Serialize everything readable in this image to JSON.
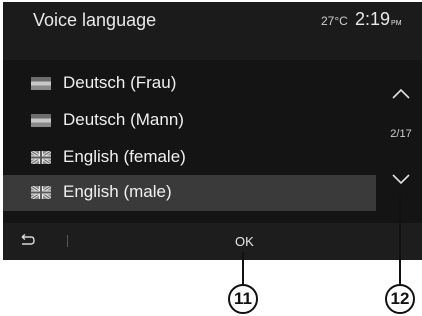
{
  "header": {
    "title": "Voice language",
    "temperature": "27°C",
    "time": "2:19",
    "ampm": "PM"
  },
  "list": {
    "items": [
      {
        "label": "Deutsch (Frau)",
        "flag": "germany-flag-icon",
        "selected": false
      },
      {
        "label": "Deutsch (Mann)",
        "flag": "germany-flag-icon",
        "selected": false
      },
      {
        "label": "English (female)",
        "flag": "uk-flag-icon",
        "selected": false
      },
      {
        "label": "English (male)",
        "flag": "uk-flag-icon",
        "selected": true
      }
    ]
  },
  "pager": {
    "up_icon": "chevron-up-icon",
    "page": "2/17",
    "down_icon": "chevron-down-icon"
  },
  "footer": {
    "back_icon": "back-arrow-icon",
    "ok_label": "OK"
  },
  "callouts": {
    "ok": "11",
    "scroll": "12"
  }
}
